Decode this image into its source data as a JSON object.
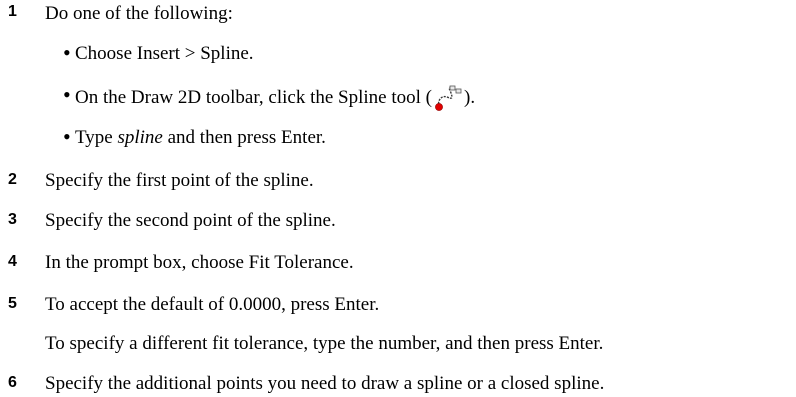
{
  "steps": [
    {
      "number": "1",
      "text": "Do one of the following:"
    },
    {
      "number": "2",
      "text": "Specify the first point of the spline."
    },
    {
      "number": "3",
      "text": "Specify the second point of the spline."
    },
    {
      "number": "4",
      "text": "In the prompt box, choose Fit Tolerance."
    },
    {
      "number": "5",
      "text": "To accept the default of 0.0000, press Enter.",
      "continuation": "To specify a different fit tolerance, type the number, and then press Enter."
    },
    {
      "number": "6",
      "text": "Specify the additional points you need to draw a spline or a closed spline."
    }
  ],
  "bullets": {
    "marker": "•",
    "b1": "Choose Insert > Spline.",
    "b2_before": "On the Draw 2D toolbar, click the Spline tool (",
    "b2_after": ").",
    "b3_italic": "spline",
    "b3_prefix": "Type ",
    "b3_suffix": " and then press Enter."
  },
  "icon": {
    "name": "spline-tool-icon",
    "accent": "#e00000"
  }
}
